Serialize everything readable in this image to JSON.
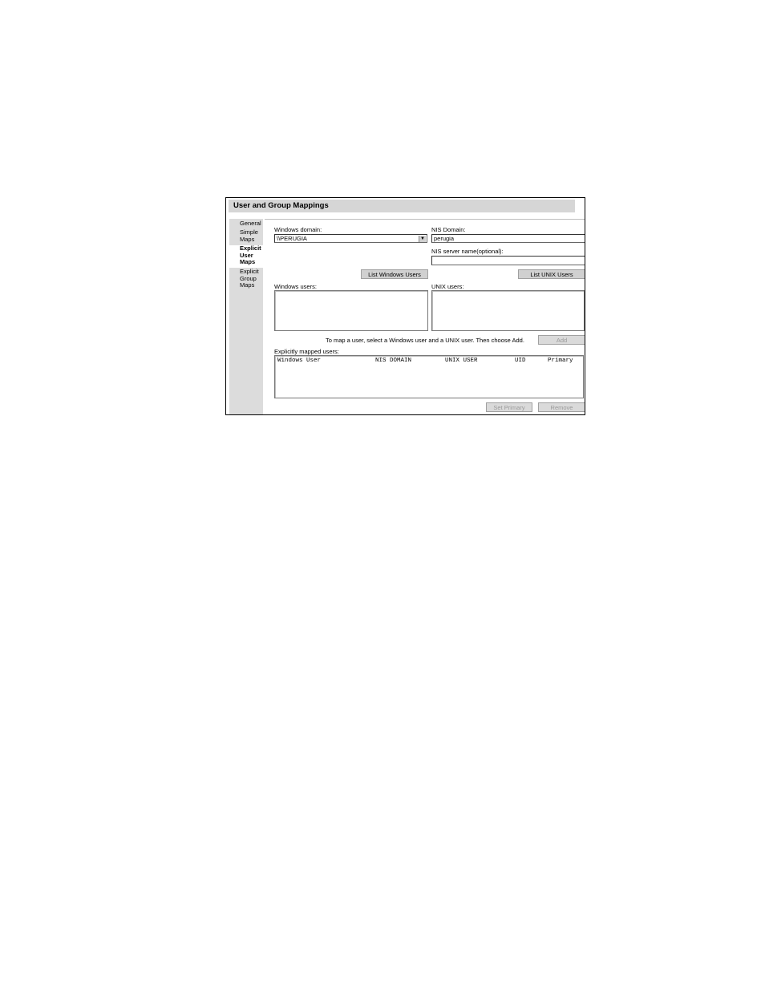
{
  "window": {
    "title": "User and Group Mappings"
  },
  "sidebar": {
    "items": [
      {
        "label": "General"
      },
      {
        "label": "Simple Maps"
      },
      {
        "label": "Explicit User Maps"
      },
      {
        "label": "Explicit Group Maps"
      }
    ]
  },
  "form": {
    "windows_domain_label": "Windows domain:",
    "windows_domain_value": "\\\\PERUGIA",
    "nis_domain_label": "NIS Domain:",
    "nis_domain_value": "perugia",
    "nis_server_label": "NIS server name(optional):",
    "nis_server_value": "",
    "list_windows_users_button": "List Windows Users",
    "list_unix_users_button": "List UNIX Users",
    "windows_users_label": "Windows users:",
    "unix_users_label": "UNIX users:",
    "instruction_text": "To map a user, select a Windows user and a UNIX user. Then choose Add.",
    "add_button": "Add",
    "mapped_users_label": "Explicitly mapped users:",
    "mapped_columns": [
      "Windows User",
      "NIS DOMAIN",
      "UNIX USER",
      "UID",
      "Primary"
    ],
    "set_primary_button": "Set Primary",
    "remove_button": "Remove"
  }
}
